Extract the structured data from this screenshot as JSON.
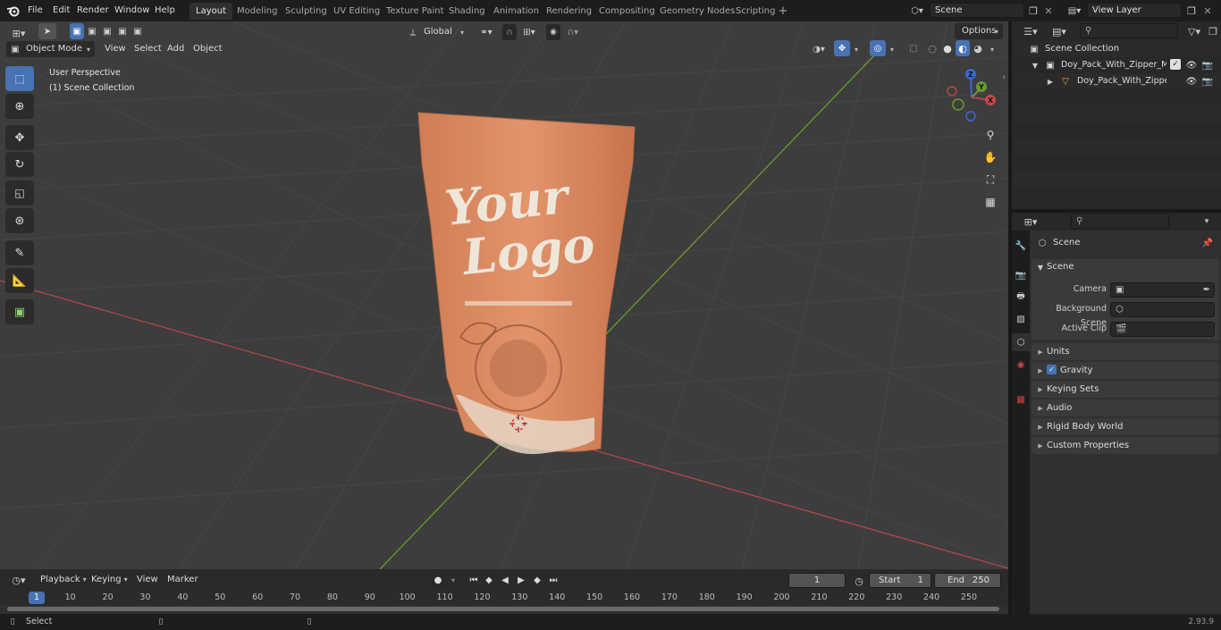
{
  "menu": [
    "File",
    "Edit",
    "Render",
    "Window",
    "Help"
  ],
  "workspaces": [
    "Layout",
    "Modeling",
    "Sculpting",
    "UV Editing",
    "Texture Paint",
    "Shading",
    "Animation",
    "Rendering",
    "Compositing",
    "Geometry Nodes",
    "Scripting"
  ],
  "active_workspace": "Layout",
  "scene_field": "Scene",
  "view_layer_field": "View Layer",
  "header": {
    "mode": "Object Mode",
    "view": "View",
    "select": "Select",
    "add": "Add",
    "object": "Object",
    "orientation": "Global",
    "options": "Options"
  },
  "viewport": {
    "perspective_label": "User Perspective",
    "collection_label": "(1) Scene Collection",
    "logo_line1": "Your",
    "logo_line2": "Logo",
    "gizmo_axes": [
      "Z",
      "Y",
      "X"
    ]
  },
  "outliner": {
    "root": "Scene Collection",
    "items": [
      {
        "label": "Doy_Pack_With_Zipper_Mock"
      },
      {
        "label": "Doy_Pack_With_Zipper_M"
      }
    ]
  },
  "properties": {
    "context": "Scene",
    "section": "Scene",
    "camera_label": "Camera",
    "background_scene_label": "Background Scene",
    "active_clip_label": "Active Clip",
    "panels": [
      "Units",
      "Gravity",
      "Keying Sets",
      "Audio",
      "Rigid Body World",
      "Custom Properties"
    ],
    "gravity_checked": true
  },
  "timeline": {
    "menus": [
      "Playback",
      "Keying",
      "View",
      "Marker"
    ],
    "current_frame": "1",
    "start_label": "Start",
    "start_value": "1",
    "end_label": "End",
    "end_value": "250",
    "ticks": [
      "1",
      "10",
      "20",
      "30",
      "40",
      "50",
      "60",
      "70",
      "80",
      "90",
      "100",
      "110",
      "120",
      "130",
      "140",
      "150",
      "160",
      "170",
      "180",
      "190",
      "200",
      "210",
      "220",
      "230",
      "240",
      "250"
    ]
  },
  "status": {
    "select": "Select",
    "version": "2.93.9"
  },
  "colors": {
    "accent": "#4772b3",
    "x_axis": "#b04848",
    "y_axis": "#6a9a32",
    "pouch": "#d9885f"
  }
}
